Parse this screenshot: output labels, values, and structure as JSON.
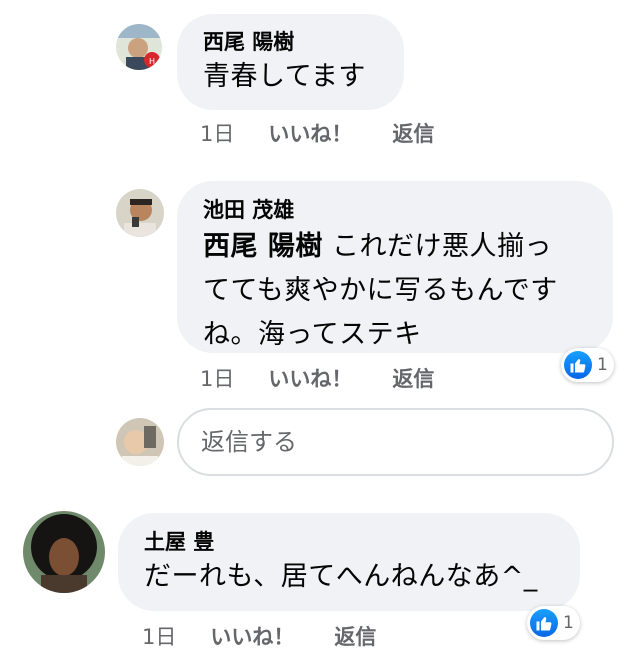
{
  "comments": [
    {
      "author": "西尾 陽樹",
      "text": "青春してます",
      "time": "1日",
      "like_label": "いいね！",
      "reply_label": "返信"
    },
    {
      "author": "池田 茂雄",
      "mention": "西尾 陽樹",
      "text_lines": [
        "これだけ悪人揃っ",
        "てても爽やかに写るもんです",
        "ね。海ってステキ"
      ],
      "time": "1日",
      "like_label": "いいね！",
      "reply_label": "返信",
      "reaction_count": "1"
    },
    {
      "author": "土屋 豊",
      "text": "だーれも、居てへんねんなあ^_",
      "time": "1日",
      "like_label": "いいね！",
      "reply_label": "返信",
      "reaction_count": "1"
    }
  ],
  "reply_input": {
    "placeholder": "返信する"
  },
  "colors": {
    "bubble": "#f0f2f5",
    "meta": "#65676b",
    "like_blue": "#1877f2"
  }
}
